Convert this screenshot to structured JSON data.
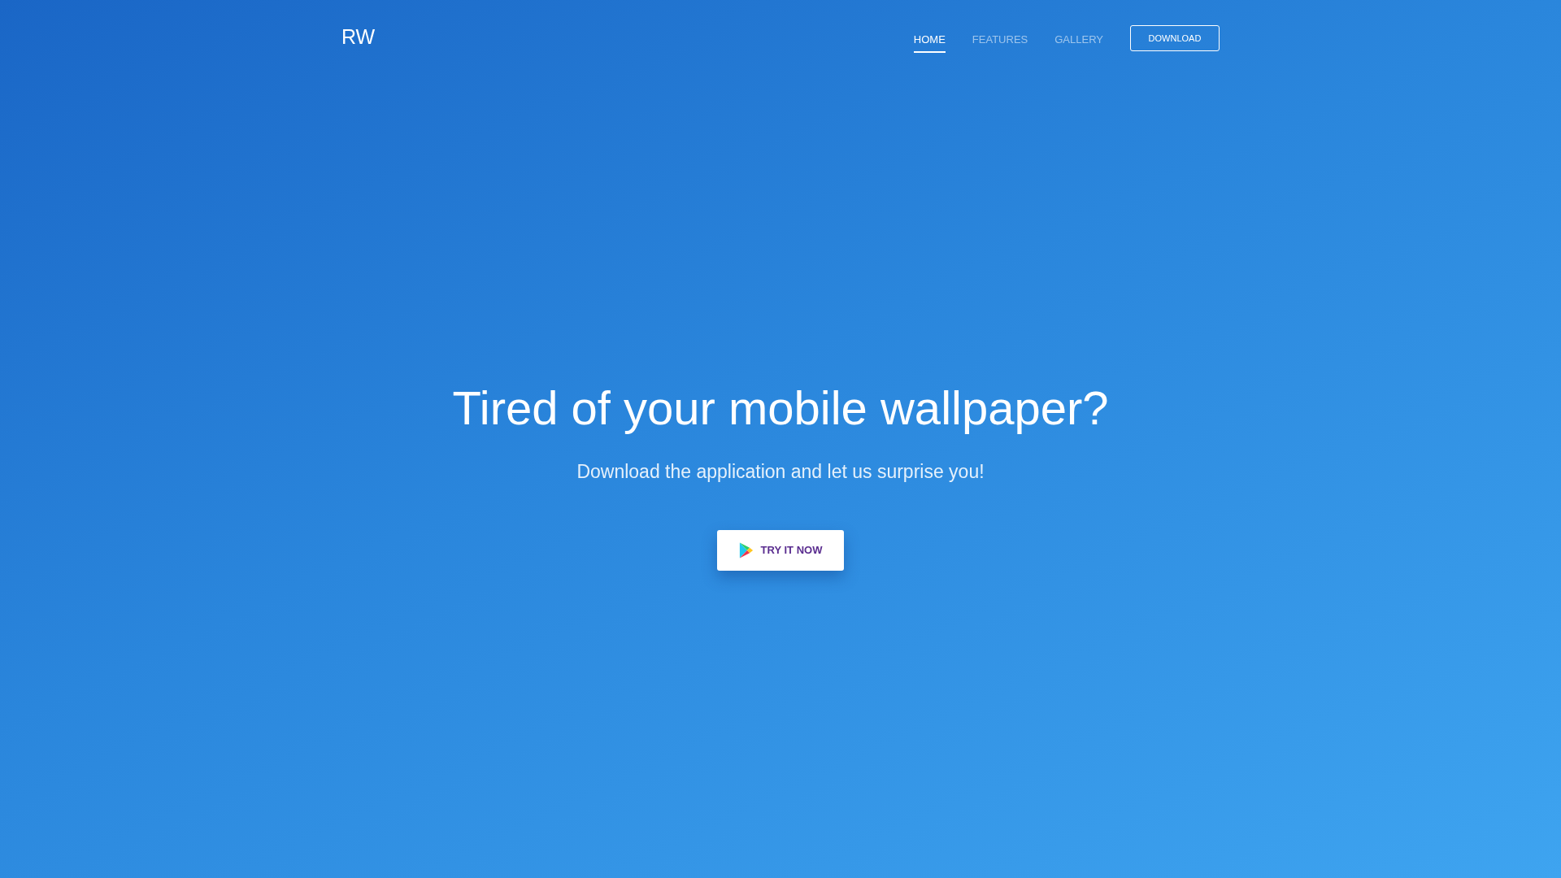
{
  "logo": "RW",
  "nav": {
    "items": [
      {
        "label": "HOME",
        "selected": true
      },
      {
        "label": "FEATURES",
        "selected": false
      },
      {
        "label": "GALLERY",
        "selected": false
      }
    ],
    "button": "DOWNLOAD"
  },
  "hero": {
    "title": "Tired of your mobile wallpaper?",
    "subtitle": "Download the application and let us surprise you!",
    "cta": "TRY IT NOW"
  }
}
